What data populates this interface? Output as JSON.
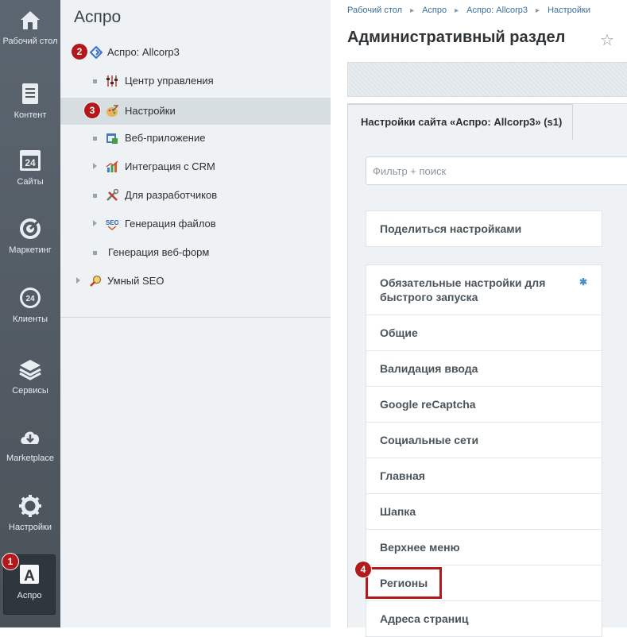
{
  "rail": {
    "items": [
      {
        "label": "Рабочий стол",
        "icon": "home-icon"
      },
      {
        "label": "Контент",
        "icon": "document-icon"
      },
      {
        "label": "Сайты",
        "icon": "calendar-24-icon"
      },
      {
        "label": "Маркетинг",
        "icon": "target-icon"
      },
      {
        "label": "Клиенты",
        "icon": "cloud-24-icon"
      },
      {
        "label": "Сервисы",
        "icon": "layers-icon"
      },
      {
        "label": "Marketplace",
        "icon": "cloud-download-icon"
      },
      {
        "label": "Настройки",
        "icon": "gear-icon"
      },
      {
        "label": "Аспро",
        "icon": "letter-a-icon",
        "active": true
      }
    ]
  },
  "menu": {
    "title": "Аспро",
    "items": [
      {
        "label": "Аспро: Allcorp3",
        "icon": "diamond-icon"
      },
      {
        "label": "Центр управления",
        "icon": "sliders-icon"
      },
      {
        "label": "Настройки",
        "icon": "palette-icon",
        "selected": true
      },
      {
        "label": "Веб-приложение",
        "icon": "web-app-icon"
      },
      {
        "label": "Интеграция с CRM",
        "icon": "chart-icon"
      },
      {
        "label": "Для разработчиков",
        "icon": "tools-icon"
      },
      {
        "label": "Генерация файлов",
        "icon": "seo-icon"
      },
      {
        "label": "Генерация веб-форм"
      },
      {
        "label": "Умный SEO",
        "icon": "magnifier-icon"
      }
    ]
  },
  "breadcrumbs": [
    "Рабочий стол",
    "Аспро",
    "Аспро: Allcorp3",
    "Настройки"
  ],
  "page_title": "Административный раздел",
  "tab_label": "Настройки сайта «Аспро: Allcorp3» (s1)",
  "filter": {
    "placeholder": "Фильтр + поиск"
  },
  "share_label": "Поделиться настройками",
  "settings_sections": [
    "Обязательные настройки для быстрого запуска",
    "Общие",
    "Валидация ввода",
    "Google reCaptcha",
    "Социальные сети",
    "Главная",
    "Шапка",
    "Верхнее меню",
    "Регионы",
    "Адреса страниц"
  ],
  "annotations": [
    "1",
    "2",
    "3",
    "4"
  ],
  "colors": {
    "annotation": "#b3181c",
    "rail_bg": "#525b63",
    "link": "#3b6e9c"
  }
}
